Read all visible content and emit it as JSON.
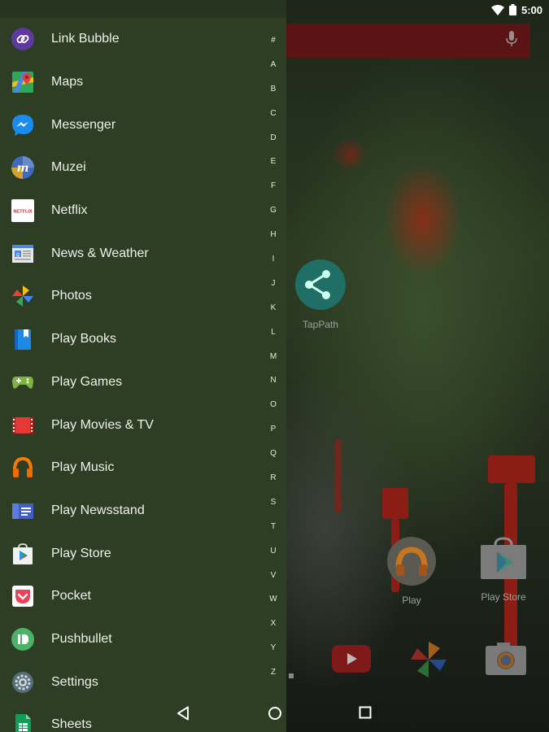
{
  "status": {
    "time": "5:00"
  },
  "desktop": {
    "tappath_label": "TapPath",
    "play_label": "Play",
    "play_store_label": "Play Store"
  },
  "drawer": {
    "apps": [
      {
        "label": "Link Bubble",
        "icon": "link-bubble-icon"
      },
      {
        "label": "Maps",
        "icon": "maps-icon"
      },
      {
        "label": "Messenger",
        "icon": "messenger-icon"
      },
      {
        "label": "Muzei",
        "icon": "muzei-icon"
      },
      {
        "label": "Netflix",
        "icon": "netflix-icon"
      },
      {
        "label": "News & Weather",
        "icon": "news-weather-icon"
      },
      {
        "label": "Photos",
        "icon": "photos-icon"
      },
      {
        "label": "Play Books",
        "icon": "play-books-icon"
      },
      {
        "label": "Play Games",
        "icon": "play-games-icon"
      },
      {
        "label": "Play Movies & TV",
        "icon": "play-movies-icon"
      },
      {
        "label": "Play Music",
        "icon": "play-music-icon"
      },
      {
        "label": "Play Newsstand",
        "icon": "play-newsstand-icon"
      },
      {
        "label": "Play Store",
        "icon": "play-store-icon"
      },
      {
        "label": "Pocket",
        "icon": "pocket-icon"
      },
      {
        "label": "Pushbullet",
        "icon": "pushbullet-icon"
      },
      {
        "label": "Settings",
        "icon": "settings-icon"
      },
      {
        "label": "Sheets",
        "icon": "sheets-icon"
      }
    ],
    "netflix_icon_text": "NETFLIX",
    "alphabet": [
      "#",
      "A",
      "B",
      "C",
      "D",
      "E",
      "F",
      "G",
      "H",
      "I",
      "J",
      "K",
      "L",
      "M",
      "N",
      "O",
      "P",
      "Q",
      "R",
      "S",
      "T",
      "U",
      "V",
      "W",
      "X",
      "Y",
      "Z"
    ]
  },
  "colors": {
    "drawer_bg": "#2e3e24",
    "search_bar": "#5b1414"
  }
}
